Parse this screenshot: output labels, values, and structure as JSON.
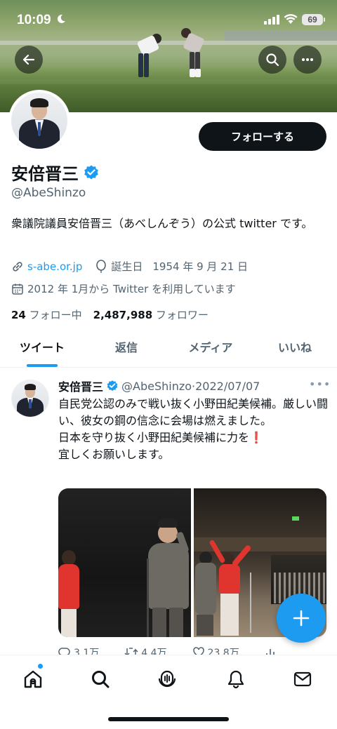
{
  "status_bar": {
    "time": "10:09",
    "battery": "69"
  },
  "profile": {
    "follow_button": "フォローする",
    "name": "安倍晋三",
    "handle": "@AbeShinzo",
    "bio": "衆議院議員安倍晋三（あべしんぞう）の公式 twitter です。",
    "website": "s-abe.or.jp",
    "birthday_label": "誕生日",
    "birthday": "1954 年 9 月 21 日",
    "joined": "2012 年 1月から Twitter を利用しています",
    "following_count": "24",
    "following_label": "フォロー中",
    "followers_count": "2,487,988",
    "followers_label": "フォロワー"
  },
  "tabs": [
    {
      "label": "ツイート",
      "active": true
    },
    {
      "label": "返信",
      "active": false
    },
    {
      "label": "メディア",
      "active": false
    },
    {
      "label": "いいね",
      "active": false
    }
  ],
  "tweet": {
    "name": "安倍晋三",
    "handle": "@AbeShinzo",
    "separator": "·",
    "date": "2022/07/07",
    "text_line1": "自民党公認のみで戦い抜く小野田紀美候補。厳しい闘い、彼女の鋼の信念に会場は燃えました。",
    "text_line2": "日本を守り抜く小野田紀美候補に力を",
    "text_emoji": "❗",
    "text_line3": "宜しくお願いします。",
    "reply_count": "3.1万",
    "retweet_count": "4.4万",
    "like_count": "23.8万"
  },
  "colors": {
    "accent": "#1d9bf0",
    "text": "#0f1419",
    "muted": "#536471"
  },
  "icons": [
    "back-arrow-icon",
    "search-icon",
    "more-icon",
    "verified-badge-icon",
    "link-icon",
    "balloon-icon",
    "calendar-icon",
    "reply-icon",
    "retweet-icon",
    "like-icon",
    "views-icon",
    "share-icon",
    "plus-icon",
    "home-icon",
    "explore-icon",
    "spaces-icon",
    "notifications-icon",
    "messages-icon"
  ]
}
